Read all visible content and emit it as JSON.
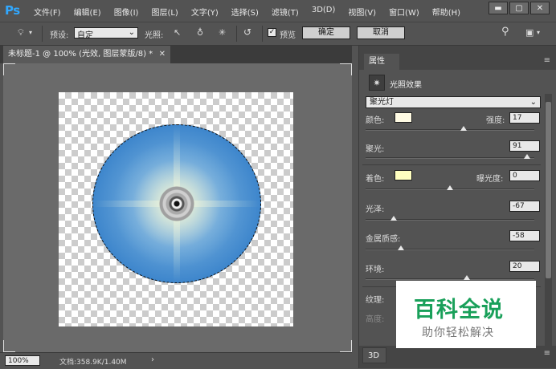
{
  "app": {
    "logo": "Ps"
  },
  "menu": [
    "文件(F)",
    "编辑(E)",
    "图像(I)",
    "图层(L)",
    "文字(Y)",
    "选择(S)",
    "滤镜(T)",
    "3D(D)",
    "视图(V)",
    "窗口(W)",
    "帮助(H)"
  ],
  "window_controls": {
    "minimize": "▬",
    "restore": "▢",
    "close": "✕"
  },
  "options": {
    "preset_label": "预设:",
    "preset_value": "自定",
    "lights_label": "光照:",
    "preview_label": "预览",
    "preview_checked": true,
    "ok_label": "确定",
    "cancel_label": "取消"
  },
  "document": {
    "tab_title": "未标题-1 @ 100% (光效, 图层蒙版/8) *",
    "tab_close": "✕"
  },
  "status": {
    "zoom": "100%",
    "doc_info": "文档:358.9K/1.40M",
    "arrow": "›"
  },
  "panel": {
    "tab": "属性",
    "menu": "≡",
    "header_title": "光照效果",
    "light_type": "聚光灯",
    "color_label": "颜色:",
    "color_value": "#fffbe4",
    "intensity_label": "强度:",
    "intensity": "17",
    "intensity_level": 0.58,
    "hotspot_label": "聚光:",
    "hotspot": "91",
    "hotspot_level": 0.955,
    "colorize_label": "着色:",
    "colorize_value": "#ffffc0",
    "exposure_label": "曝光度:",
    "exposure": "0",
    "exposure_level": 0.5,
    "gloss_label": "光泽:",
    "gloss": "-67",
    "gloss_level": 0.165,
    "metallic_label": "金属质感:",
    "metallic": "-58",
    "metallic_level": 0.21,
    "ambience_label": "环境:",
    "ambience": "20",
    "ambience_level": 0.6,
    "texture_label": "纹理:",
    "height_label": "高度:",
    "bottom_tab": "3D",
    "bottom_menu": "≡"
  },
  "watermark": {
    "title": "百科全说",
    "subtitle": "助你轻松解决"
  },
  "colors": {
    "ui_bg": "#535353",
    "canvas_bg": "#6a6a6a",
    "orb_blue": "#2b78c6",
    "watermark_green": "#19a05a"
  }
}
